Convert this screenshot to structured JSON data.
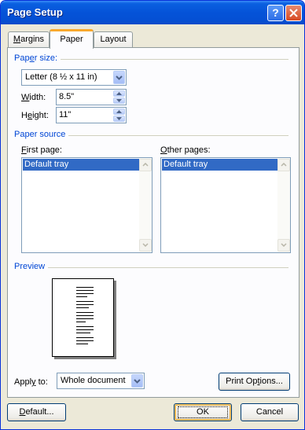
{
  "window": {
    "title": "Page Setup",
    "help_glyph": "?",
    "title_icons": [
      "help-icon",
      "close-icon"
    ]
  },
  "tabs": [
    {
      "label": "Margins",
      "mnemonic": "M",
      "rest": "argins",
      "selected": false
    },
    {
      "label": "Paper",
      "mnemonic": "",
      "rest": "Paper",
      "selected": true
    },
    {
      "label": "Layout",
      "mnemonic": "",
      "rest": "Layout",
      "selected": false
    }
  ],
  "paper_size": {
    "group_label": "Paper size",
    "group_mn": "e",
    "combo_value": "Letter (8 ½ x 11 in)",
    "width_label": {
      "pre": "",
      "mn": "W",
      "post": "idth:"
    },
    "width_value": "8.5\"",
    "height_label": {
      "pre": "H",
      "mn": "e",
      "post": "ight:"
    },
    "height_value": "11\""
  },
  "paper_source": {
    "group_label": "Paper source",
    "first_page_label": {
      "mn": "F",
      "post": "irst page:"
    },
    "first_page_items": [
      "Default tray"
    ],
    "other_pages_label": {
      "mn": "O",
      "post": "ther pages:"
    },
    "other_pages_items": [
      "Default tray"
    ]
  },
  "preview": {
    "group_label": "Preview",
    "apply_to_label": {
      "pre": "Appl",
      "mn": "y",
      "post": " to:"
    },
    "apply_to_value": "Whole document",
    "print_options": {
      "pre": "Print Op",
      "mn": "t",
      "post": "ions..."
    }
  },
  "footer": {
    "default_button": {
      "mn": "D",
      "post": "efault..."
    },
    "ok_label": "OK",
    "cancel_label": "Cancel"
  },
  "colors": {
    "titlebar": "#0553d8",
    "group_label": "#0046d5",
    "dialog_bg": "#ece9d8",
    "selection": "#316ac5",
    "tab_accent": "#f9a92d"
  }
}
